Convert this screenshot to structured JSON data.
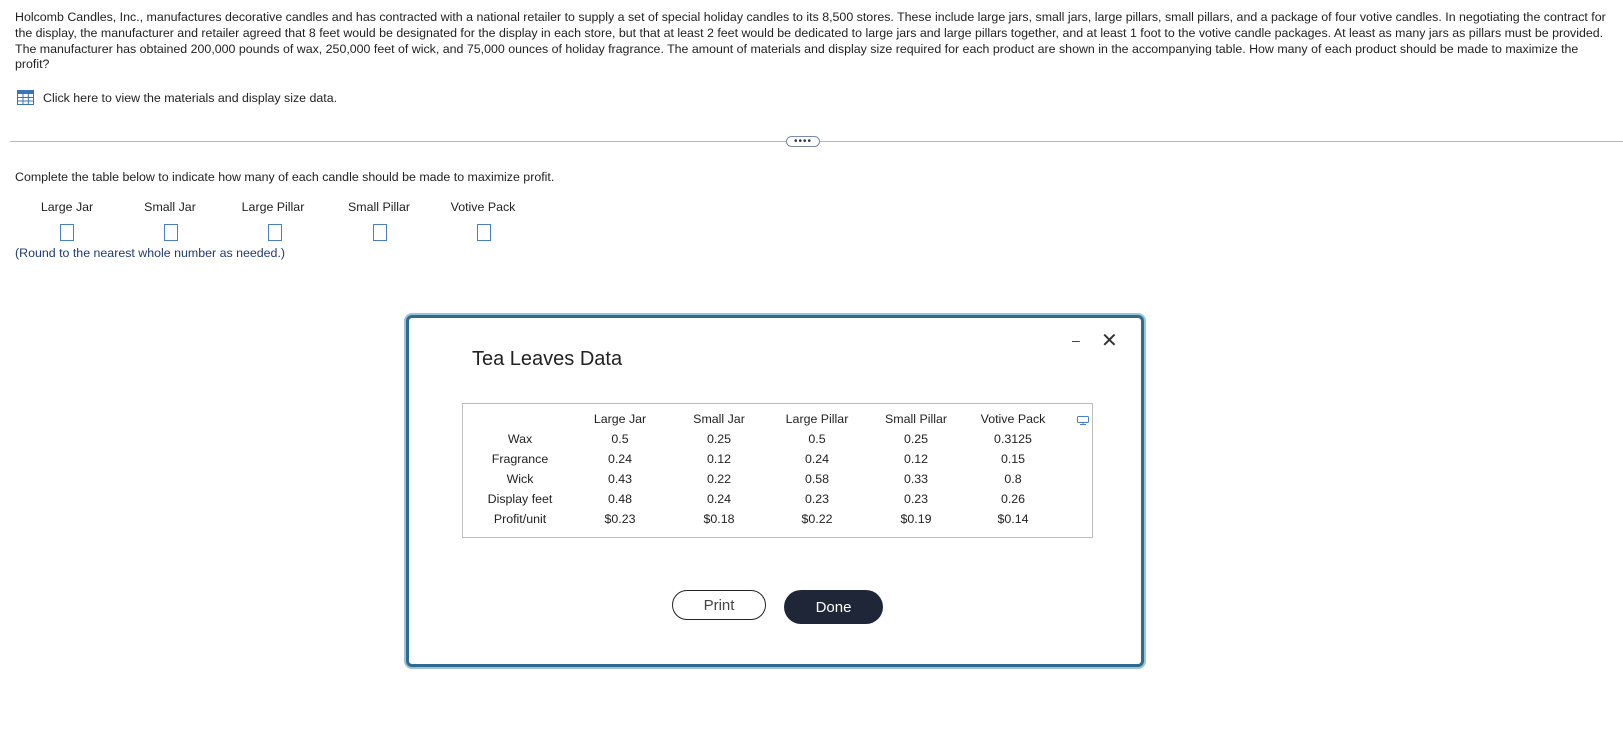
{
  "problem_text": "Holcomb Candles, Inc., manufactures decorative candles and has contracted with a national retailer to supply a set of special holiday candles to its 8,500 stores. These include large jars, small jars, large pillars, small pillars, and a package of four votive candles. In negotiating the contract for the display, the manufacturer and retailer agreed that 8 feet would be designated for the display in each store, but that at least 2 feet would be dedicated to large jars and large pillars together, and at least 1 foot to the votive candle packages. At least as many jars as pillars must be provided. The manufacturer has obtained 200,000 pounds of wax, 250,000 feet of wick, and 75,000 ounces of holiday fragrance. The amount of materials and display size required for each product are shown in the accompanying table. How many of each product should be made to maximize the profit?",
  "data_link_label": "Click here to view the materials and display size data.",
  "ellipsis_label": "••••",
  "instruction": "Complete the table below to indicate how many of each candle should be made to maximize profit.",
  "answer_columns": [
    "Large Jar",
    "Small Jar",
    "Large Pillar",
    "Small Pillar",
    "Votive Pack"
  ],
  "round_note": "(Round to the nearest whole number as needed.)",
  "modal": {
    "title": "Tea Leaves Data",
    "minimize": "–",
    "close": "✕",
    "columns": [
      "Large Jar",
      "Small Jar",
      "Large Pillar",
      "Small Pillar",
      "Votive Pack"
    ],
    "rows": [
      {
        "label": "Wax",
        "values": [
          "0.5",
          "0.25",
          "0.5",
          "0.25",
          "0.3125"
        ]
      },
      {
        "label": "Fragrance",
        "values": [
          "0.24",
          "0.12",
          "0.24",
          "0.12",
          "0.15"
        ]
      },
      {
        "label": "Wick",
        "values": [
          "0.43",
          "0.22",
          "0.58",
          "0.33",
          "0.8"
        ]
      },
      {
        "label": "Display feet",
        "values": [
          "0.48",
          "0.24",
          "0.23",
          "0.23",
          "0.26"
        ]
      },
      {
        "label": "Profit/unit",
        "values": [
          "$0.23",
          "$0.18",
          "$0.22",
          "$0.19",
          "$0.14"
        ]
      }
    ],
    "print_label": "Print",
    "done_label": "Done"
  },
  "colors": {
    "accent_blue": "#4a7fc1",
    "note_text": "#1f3b73",
    "done_button": "#1e2637",
    "modal_border": "#2f6b8f"
  }
}
